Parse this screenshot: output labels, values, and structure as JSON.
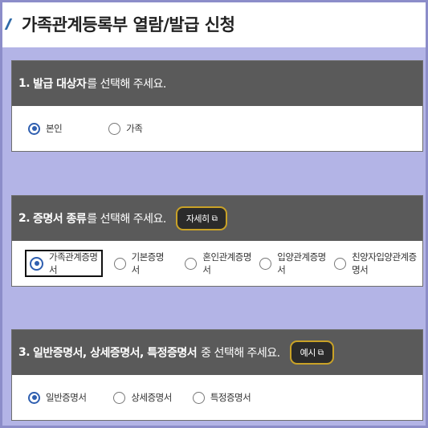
{
  "page_title": "가족관계등록부 열람/발급 신청",
  "section1": {
    "number": "1.",
    "bold_label": "발급 대상자",
    "rest_label": "를 선택해 주세요.",
    "options": [
      "본인",
      "가족"
    ],
    "selected_index": 0
  },
  "section2": {
    "number": "2.",
    "bold_label": "증명서 종류",
    "rest_label": "를 선택해 주세요.",
    "help_button": "자세히",
    "options": [
      "가족관계증명서",
      "기본증명서",
      "혼인관계증명서",
      "입양관계증명서",
      "친양자입양관계증명서"
    ],
    "selected_index": 0
  },
  "section3": {
    "number": "3.",
    "bold_label": "일반증명서, 상세증명서, 특정증명서",
    "rest_label": "중 선택해 주세요.",
    "help_button": "예시",
    "options": [
      "일반증명서",
      "상세증명서",
      "특정증명서"
    ],
    "selected_index": 0
  },
  "colors": {
    "background": "#b3b4e6",
    "section_header": "#5a5a5a",
    "help_button_border": "#c9a227",
    "radio_selected": "#2f5fb0"
  }
}
